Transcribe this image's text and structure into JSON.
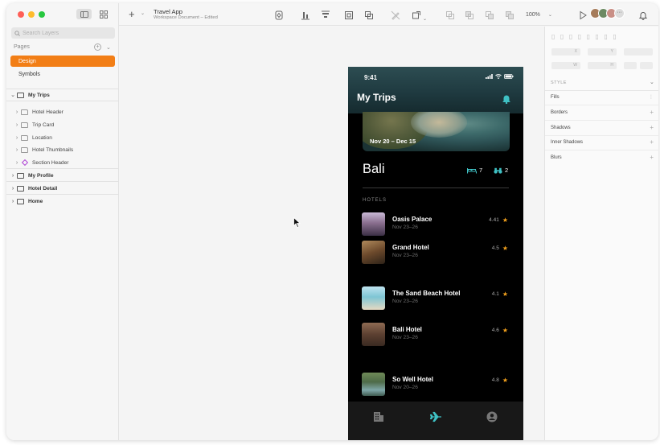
{
  "app": {
    "window_title": "Travel App",
    "doc_status": "Workspace Document – Edited"
  },
  "search": {
    "placeholder": "Search Layers"
  },
  "pages": {
    "header": "Pages",
    "items": [
      {
        "label": "Design",
        "active": true
      },
      {
        "label": "Symbols",
        "active": false
      }
    ]
  },
  "layers": [
    {
      "label": "My Trips",
      "level": 0,
      "kind": "artboard",
      "expanded": true
    },
    {
      "label": "Hotel Header",
      "level": 1,
      "kind": "folder"
    },
    {
      "label": "Trip Card",
      "level": 1,
      "kind": "folder"
    },
    {
      "label": "Location",
      "level": 1,
      "kind": "folder"
    },
    {
      "label": "Hotel Thumbnails",
      "level": 1,
      "kind": "folder"
    },
    {
      "label": "Section Header",
      "level": 1,
      "kind": "symbol"
    },
    {
      "label": "My Profile",
      "level": 0,
      "kind": "artboard"
    },
    {
      "label": "Hotel Detail",
      "level": 0,
      "kind": "artboard"
    },
    {
      "label": "Home",
      "level": 0,
      "kind": "artboard"
    }
  ],
  "toolbar": {
    "zoom": "100%"
  },
  "inspector": {
    "fields": {
      "x": "X",
      "y": "Y",
      "w": "W",
      "h": "H"
    },
    "style_header": "STYLE",
    "sections": [
      "Fills",
      "Borders",
      "Shadows",
      "Inner Shadows",
      "Blurs"
    ]
  },
  "phone": {
    "time": "9:41",
    "title": "My Trips",
    "trip_dates": "Nov 20 – Dec 15",
    "destination": "Bali",
    "beds_count": "7",
    "binoculars_count": "2",
    "hotels_header": "HOTELS",
    "hotels": [
      {
        "name": "Oasis Palace",
        "dates": "Nov 23–26",
        "rating": "4.41"
      },
      {
        "name": "Grand Hotel",
        "dates": "Nov 23–26",
        "rating": "4.5"
      },
      {
        "name": "The Sand Beach Hotel",
        "dates": "Nov 23–26",
        "rating": "4.1"
      },
      {
        "name": "Bali Hotel",
        "dates": "Nov 23–26",
        "rating": "4.6"
      },
      {
        "name": "So Well Hotel",
        "dates": "Nov 20–26",
        "rating": "4.8"
      }
    ]
  },
  "colors": {
    "accent": "#f27e16",
    "phone_accent": "#3fc1c4",
    "star": "#f4a21d"
  }
}
